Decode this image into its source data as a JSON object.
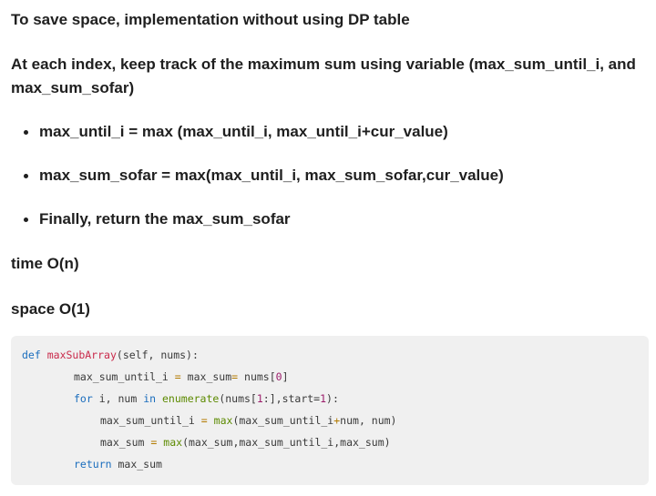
{
  "paragraphs": {
    "intro": "To save space, implementation without using DP table",
    "tracking": "At each index, keep track of the maximum sum using variable (max_sum_until_i, and max_sum_sofar)",
    "time": "time O(n)",
    "space": "space O(1)"
  },
  "bullets": [
    "max_until_i = max (max_until_i, max_until_i+cur_value)",
    "max_sum_sofar = max(max_until_i, max_sum_sofar,cur_value)",
    "Finally, return the max_sum_sofar"
  ],
  "code": {
    "line1": {
      "kw": "def",
      "fn": "maxSubArray",
      "rest": "(self, nums):"
    },
    "line2": {
      "a": "max_sum_until_i",
      "eq1": "=",
      "b": "max_sum",
      "eq2": "=",
      "c": "nums[",
      "idx": "0",
      "d": "]"
    },
    "line3": {
      "kw_for": "for",
      "vars": "i, num",
      "kw_in": "in",
      "bi": "enumerate",
      "a": "(nums[",
      "n1": "1",
      "b": ":],start=",
      "n2": "1",
      "c": "):"
    },
    "line4": {
      "a": "max_sum_until_i",
      "eq": "=",
      "bi": "max",
      "b": "(max_sum_until_i",
      "plus": "+",
      "c": "num, num)"
    },
    "line5": {
      "a": "max_sum",
      "eq": "=",
      "bi": "max",
      "b": "(max_sum,max_sum_until_i,max_sum)"
    },
    "line6": {
      "kw": "return",
      "rest": "max_sum"
    }
  }
}
